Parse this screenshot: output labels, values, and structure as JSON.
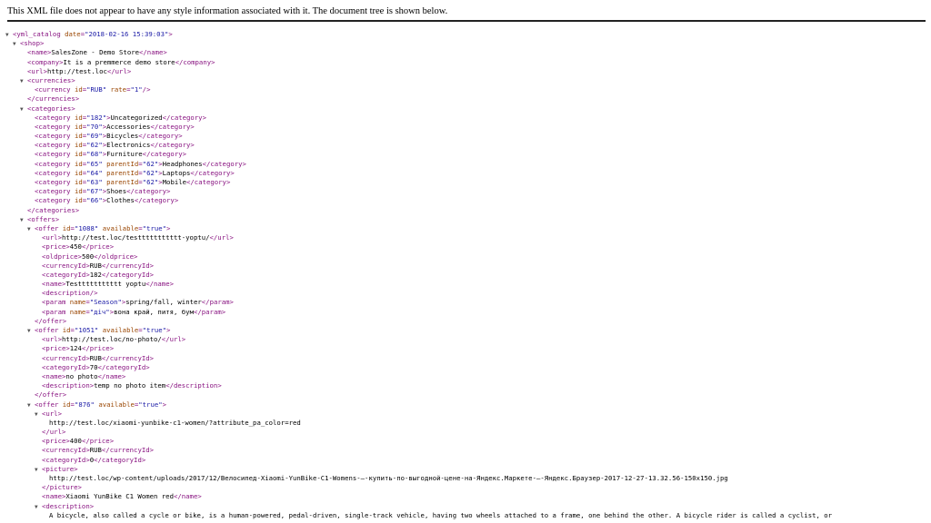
{
  "banner": "This XML file does not appear to have any style information associated with it. The document tree is shown below.",
  "lines": [
    {
      "indent": 0,
      "tog": true,
      "parts": [
        [
          "t",
          "<yml_catalog"
        ],
        [
          "an",
          " date"
        ],
        [
          "t",
          "="
        ],
        [
          "av",
          "\"2018-02-16 15:39:03\""
        ],
        [
          "t",
          ">"
        ]
      ]
    },
    {
      "indent": 1,
      "tog": true,
      "parts": [
        [
          "t",
          "<shop>"
        ]
      ]
    },
    {
      "indent": 3,
      "parts": [
        [
          "t",
          "<name>"
        ],
        [
          "tx",
          "SalesZone - Demo Store"
        ],
        [
          "t",
          "</name>"
        ]
      ]
    },
    {
      "indent": 3,
      "parts": [
        [
          "t",
          "<company>"
        ],
        [
          "tx",
          "It is a premmerce demo store"
        ],
        [
          "t",
          "</company>"
        ]
      ]
    },
    {
      "indent": 3,
      "parts": [
        [
          "t",
          "<url>"
        ],
        [
          "tx",
          "http://test.loc"
        ],
        [
          "t",
          "</url>"
        ]
      ]
    },
    {
      "indent": 2,
      "tog": true,
      "parts": [
        [
          "t",
          "<currencies>"
        ]
      ]
    },
    {
      "indent": 4,
      "parts": [
        [
          "t",
          "<currency"
        ],
        [
          "an",
          " id"
        ],
        [
          "t",
          "="
        ],
        [
          "av",
          "\"RUB\""
        ],
        [
          "an",
          " rate"
        ],
        [
          "t",
          "="
        ],
        [
          "av",
          "\"1\""
        ],
        [
          "t",
          "/>"
        ]
      ]
    },
    {
      "indent": 3,
      "parts": [
        [
          "t",
          "</currencies>"
        ]
      ]
    },
    {
      "indent": 2,
      "tog": true,
      "parts": [
        [
          "t",
          "<categories>"
        ]
      ]
    },
    {
      "indent": 4,
      "parts": [
        [
          "t",
          "<category"
        ],
        [
          "an",
          " id"
        ],
        [
          "t",
          "="
        ],
        [
          "av",
          "\"182\""
        ],
        [
          "t",
          ">"
        ],
        [
          "tx",
          "Uncategorized"
        ],
        [
          "t",
          "</category>"
        ]
      ]
    },
    {
      "indent": 4,
      "parts": [
        [
          "t",
          "<category"
        ],
        [
          "an",
          " id"
        ],
        [
          "t",
          "="
        ],
        [
          "av",
          "\"70\""
        ],
        [
          "t",
          ">"
        ],
        [
          "tx",
          "Accessories"
        ],
        [
          "t",
          "</category>"
        ]
      ]
    },
    {
      "indent": 4,
      "parts": [
        [
          "t",
          "<category"
        ],
        [
          "an",
          " id"
        ],
        [
          "t",
          "="
        ],
        [
          "av",
          "\"69\""
        ],
        [
          "t",
          ">"
        ],
        [
          "tx",
          "Bicycles"
        ],
        [
          "t",
          "</category>"
        ]
      ]
    },
    {
      "indent": 4,
      "parts": [
        [
          "t",
          "<category"
        ],
        [
          "an",
          " id"
        ],
        [
          "t",
          "="
        ],
        [
          "av",
          "\"62\""
        ],
        [
          "t",
          ">"
        ],
        [
          "tx",
          "Electronics"
        ],
        [
          "t",
          "</category>"
        ]
      ]
    },
    {
      "indent": 4,
      "parts": [
        [
          "t",
          "<category"
        ],
        [
          "an",
          " id"
        ],
        [
          "t",
          "="
        ],
        [
          "av",
          "\"68\""
        ],
        [
          "t",
          ">"
        ],
        [
          "tx",
          "Furniture"
        ],
        [
          "t",
          "</category>"
        ]
      ]
    },
    {
      "indent": 4,
      "parts": [
        [
          "t",
          "<category"
        ],
        [
          "an",
          " id"
        ],
        [
          "t",
          "="
        ],
        [
          "av",
          "\"65\""
        ],
        [
          "an",
          " parentId"
        ],
        [
          "t",
          "="
        ],
        [
          "av",
          "\"62\""
        ],
        [
          "t",
          ">"
        ],
        [
          "tx",
          "Headphones"
        ],
        [
          "t",
          "</category>"
        ]
      ]
    },
    {
      "indent": 4,
      "parts": [
        [
          "t",
          "<category"
        ],
        [
          "an",
          " id"
        ],
        [
          "t",
          "="
        ],
        [
          "av",
          "\"64\""
        ],
        [
          "an",
          " parentId"
        ],
        [
          "t",
          "="
        ],
        [
          "av",
          "\"62\""
        ],
        [
          "t",
          ">"
        ],
        [
          "tx",
          "Laptops"
        ],
        [
          "t",
          "</category>"
        ]
      ]
    },
    {
      "indent": 4,
      "parts": [
        [
          "t",
          "<category"
        ],
        [
          "an",
          " id"
        ],
        [
          "t",
          "="
        ],
        [
          "av",
          "\"63\""
        ],
        [
          "an",
          " parentId"
        ],
        [
          "t",
          "="
        ],
        [
          "av",
          "\"62\""
        ],
        [
          "t",
          ">"
        ],
        [
          "tx",
          "Mobile"
        ],
        [
          "t",
          "</category>"
        ]
      ]
    },
    {
      "indent": 4,
      "parts": [
        [
          "t",
          "<category"
        ],
        [
          "an",
          " id"
        ],
        [
          "t",
          "="
        ],
        [
          "av",
          "\"67\""
        ],
        [
          "t",
          ">"
        ],
        [
          "tx",
          "Shoes"
        ],
        [
          "t",
          "</category>"
        ]
      ]
    },
    {
      "indent": 4,
      "parts": [
        [
          "t",
          "<category"
        ],
        [
          "an",
          " id"
        ],
        [
          "t",
          "="
        ],
        [
          "av",
          "\"66\""
        ],
        [
          "t",
          ">"
        ],
        [
          "tx",
          "Clothes"
        ],
        [
          "t",
          "</category>"
        ]
      ]
    },
    {
      "indent": 3,
      "parts": [
        [
          "t",
          "</categories>"
        ]
      ]
    },
    {
      "indent": 2,
      "tog": true,
      "parts": [
        [
          "t",
          "<offers>"
        ]
      ]
    },
    {
      "indent": 3,
      "tog": true,
      "parts": [
        [
          "t",
          "<offer"
        ],
        [
          "an",
          " id"
        ],
        [
          "t",
          "="
        ],
        [
          "av",
          "\"1088\""
        ],
        [
          "an",
          " available"
        ],
        [
          "t",
          "="
        ],
        [
          "av",
          "\"true\""
        ],
        [
          "t",
          ">"
        ]
      ]
    },
    {
      "indent": 5,
      "parts": [
        [
          "t",
          "<url>"
        ],
        [
          "tx",
          "http://test.loc/testtttttttttt-yoptu/"
        ],
        [
          "t",
          "</url>"
        ]
      ]
    },
    {
      "indent": 5,
      "parts": [
        [
          "t",
          "<price>"
        ],
        [
          "tx",
          "450"
        ],
        [
          "t",
          "</price>"
        ]
      ]
    },
    {
      "indent": 5,
      "parts": [
        [
          "t",
          "<oldprice>"
        ],
        [
          "tx",
          "500"
        ],
        [
          "t",
          "</oldprice>"
        ]
      ]
    },
    {
      "indent": 5,
      "parts": [
        [
          "t",
          "<currencyId>"
        ],
        [
          "tx",
          "RUB"
        ],
        [
          "t",
          "</currencyId>"
        ]
      ]
    },
    {
      "indent": 5,
      "parts": [
        [
          "t",
          "<categoryId>"
        ],
        [
          "tx",
          "182"
        ],
        [
          "t",
          "</categoryId>"
        ]
      ]
    },
    {
      "indent": 5,
      "parts": [
        [
          "t",
          "<name>"
        ],
        [
          "tx",
          "Testtttttttttt yoptu"
        ],
        [
          "t",
          "</name>"
        ]
      ]
    },
    {
      "indent": 5,
      "parts": [
        [
          "t",
          "<description/>"
        ]
      ]
    },
    {
      "indent": 5,
      "parts": [
        [
          "t",
          "<param"
        ],
        [
          "an",
          " name"
        ],
        [
          "t",
          "="
        ],
        [
          "av",
          "\"Season\""
        ],
        [
          "t",
          ">"
        ],
        [
          "tx",
          "spring/fall, winter"
        ],
        [
          "t",
          "</param>"
        ]
      ]
    },
    {
      "indent": 5,
      "parts": [
        [
          "t",
          "<param"
        ],
        [
          "an",
          " name"
        ],
        [
          "t",
          "="
        ],
        [
          "av",
          "\"дiч\""
        ],
        [
          "t",
          ">"
        ],
        [
          "tx",
          "вона край, питя, бум"
        ],
        [
          "t",
          "</param>"
        ]
      ]
    },
    {
      "indent": 4,
      "parts": [
        [
          "t",
          "</offer>"
        ]
      ]
    },
    {
      "indent": 3,
      "tog": true,
      "parts": [
        [
          "t",
          "<offer"
        ],
        [
          "an",
          " id"
        ],
        [
          "t",
          "="
        ],
        [
          "av",
          "\"1051\""
        ],
        [
          "an",
          " available"
        ],
        [
          "t",
          "="
        ],
        [
          "av",
          "\"true\""
        ],
        [
          "t",
          ">"
        ]
      ]
    },
    {
      "indent": 5,
      "parts": [
        [
          "t",
          "<url>"
        ],
        [
          "tx",
          "http://test.loc/no-photo/"
        ],
        [
          "t",
          "</url>"
        ]
      ]
    },
    {
      "indent": 5,
      "parts": [
        [
          "t",
          "<price>"
        ],
        [
          "tx",
          "124"
        ],
        [
          "t",
          "</price>"
        ]
      ]
    },
    {
      "indent": 5,
      "parts": [
        [
          "t",
          "<currencyId>"
        ],
        [
          "tx",
          "RUB"
        ],
        [
          "t",
          "</currencyId>"
        ]
      ]
    },
    {
      "indent": 5,
      "parts": [
        [
          "t",
          "<categoryId>"
        ],
        [
          "tx",
          "70"
        ],
        [
          "t",
          "</categoryId>"
        ]
      ]
    },
    {
      "indent": 5,
      "parts": [
        [
          "t",
          "<name>"
        ],
        [
          "tx",
          "no photo"
        ],
        [
          "t",
          "</name>"
        ]
      ]
    },
    {
      "indent": 5,
      "parts": [
        [
          "t",
          "<description>"
        ],
        [
          "tx",
          "temp no photo item"
        ],
        [
          "t",
          "</description>"
        ]
      ]
    },
    {
      "indent": 4,
      "parts": [
        [
          "t",
          "</offer>"
        ]
      ]
    },
    {
      "indent": 3,
      "tog": true,
      "parts": [
        [
          "t",
          "<offer"
        ],
        [
          "an",
          " id"
        ],
        [
          "t",
          "="
        ],
        [
          "av",
          "\"876\""
        ],
        [
          "an",
          " available"
        ],
        [
          "t",
          "="
        ],
        [
          "av",
          "\"true\""
        ],
        [
          "t",
          ">"
        ]
      ]
    },
    {
      "indent": 4,
      "tog": true,
      "parts": [
        [
          "t",
          "<url>"
        ]
      ]
    },
    {
      "indent": 6,
      "parts": [
        [
          "tx",
          "http://test.loc/xiaomi-yunbike-c1-women/?attribute_pa_color=red"
        ]
      ]
    },
    {
      "indent": 5,
      "parts": [
        [
          "t",
          "</url>"
        ]
      ]
    },
    {
      "indent": 5,
      "parts": [
        [
          "t",
          "<price>"
        ],
        [
          "tx",
          "400"
        ],
        [
          "t",
          "</price>"
        ]
      ]
    },
    {
      "indent": 5,
      "parts": [
        [
          "t",
          "<currencyId>"
        ],
        [
          "tx",
          "RUB"
        ],
        [
          "t",
          "</currencyId>"
        ]
      ]
    },
    {
      "indent": 5,
      "parts": [
        [
          "t",
          "<categoryId>"
        ],
        [
          "tx",
          "0"
        ],
        [
          "t",
          "</categoryId>"
        ]
      ]
    },
    {
      "indent": 4,
      "tog": true,
      "parts": [
        [
          "t",
          "<picture>"
        ]
      ]
    },
    {
      "indent": 6,
      "parts": [
        [
          "tx",
          "http://test.loc/wp-content/uploads/2017/12/Велосипед-Xiaomi-YunBike-C1-Womens-—-купить-по-выгодной-цене-на-Яндекс.Маркете-—-Яндекс.Браузер-2017-12-27-13.32.56-150x150.jpg"
        ]
      ]
    },
    {
      "indent": 5,
      "parts": [
        [
          "t",
          "</picture>"
        ]
      ]
    },
    {
      "indent": 5,
      "parts": [
        [
          "t",
          "<name>"
        ],
        [
          "tx",
          "Xiaomi YunBike C1 Women red"
        ],
        [
          "t",
          "</name>"
        ]
      ]
    },
    {
      "indent": 4,
      "tog": true,
      "parts": [
        [
          "t",
          "<description>"
        ]
      ]
    },
    {
      "indent": 6,
      "parts": [
        [
          "tx",
          "A bicycle, also called a cycle or bike, is a human-powered, pedal-driven, single-track vehicle, having two wheels attached to a frame, one behind the other. A bicycle rider is called a cyclist, or"
        ]
      ]
    }
  ]
}
